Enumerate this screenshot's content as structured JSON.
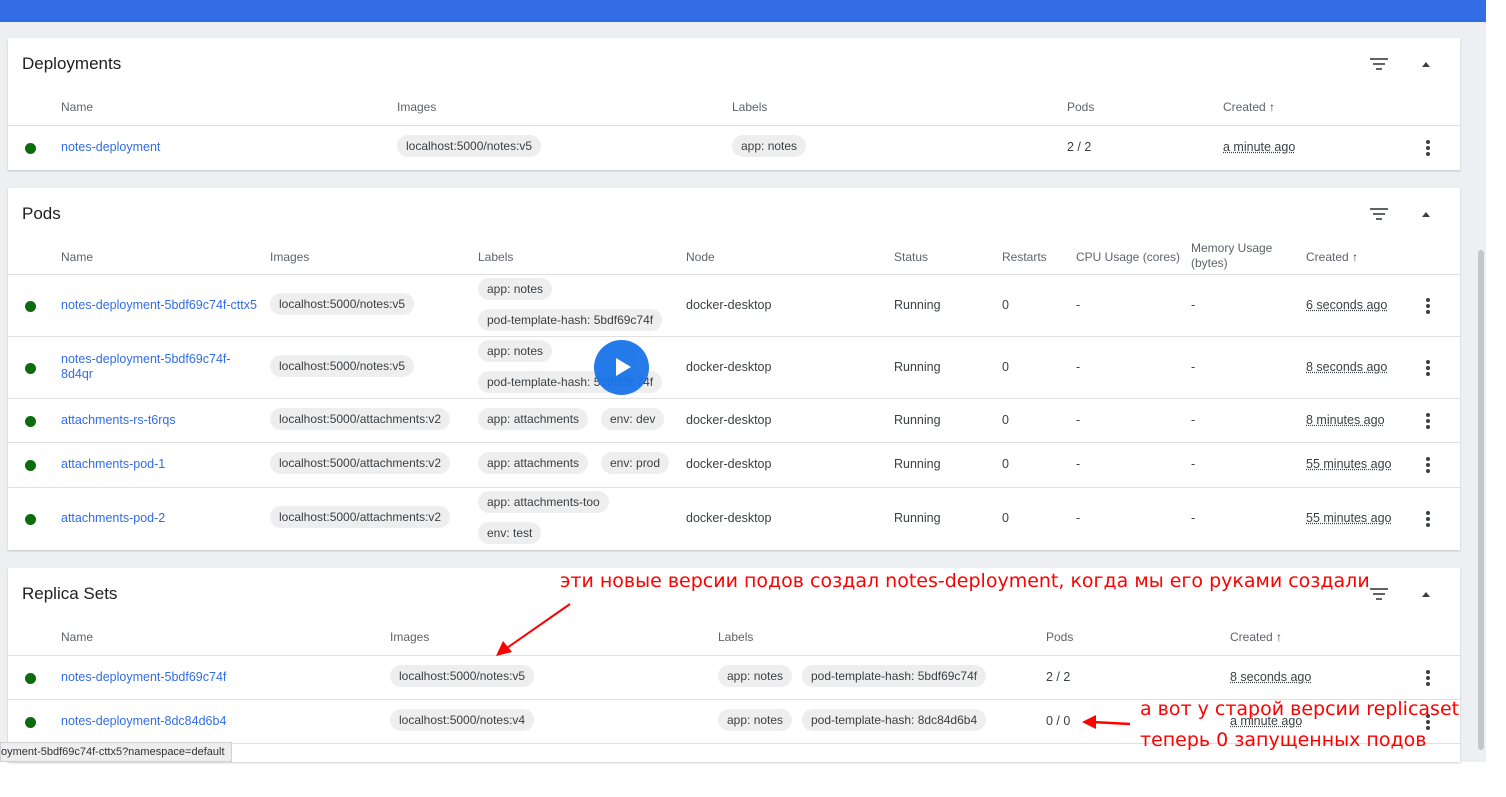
{
  "deployments": {
    "title": "Deployments",
    "headers": {
      "name": "Name",
      "images": "Images",
      "labels": "Labels",
      "pods": "Pods",
      "created": "Created"
    },
    "rows": [
      {
        "name": "notes-deployment",
        "image": "localhost:5000/notes:v5",
        "labels": [
          "app: notes"
        ],
        "pods": "2 / 2",
        "created": "a minute ago"
      }
    ]
  },
  "pods": {
    "title": "Pods",
    "headers": {
      "name": "Name",
      "images": "Images",
      "labels": "Labels",
      "node": "Node",
      "status": "Status",
      "restarts": "Restarts",
      "cpu": "CPU Usage (cores)",
      "memory": "Memory Usage (bytes)",
      "created": "Created"
    },
    "rows": [
      {
        "name": "notes-deployment-5bdf69c74f-cttx5",
        "image": "localhost:5000/notes:v5",
        "labels": [
          "app: notes",
          "pod-template-hash: 5bdf69c74f"
        ],
        "node": "docker-desktop",
        "status": "Running",
        "restarts": "0",
        "cpu": "-",
        "memory": "-",
        "created": "6 seconds ago"
      },
      {
        "name": "notes-deployment-5bdf69c74f-8d4qr",
        "image": "localhost:5000/notes:v5",
        "labels": [
          "app: notes",
          "pod-template-hash: 5bdf69c74f"
        ],
        "node": "docker-desktop",
        "status": "Running",
        "restarts": "0",
        "cpu": "-",
        "memory": "-",
        "created": "8 seconds ago"
      },
      {
        "name": "attachments-rs-t6rqs",
        "image": "localhost:5000/attachments:v2",
        "labels": [
          "app: attachments",
          "env: dev"
        ],
        "node": "docker-desktop",
        "status": "Running",
        "restarts": "0",
        "cpu": "-",
        "memory": "-",
        "created": "8 minutes ago"
      },
      {
        "name": "attachments-pod-1",
        "image": "localhost:5000/attachments:v2",
        "labels": [
          "app: attachments",
          "env: prod"
        ],
        "node": "docker-desktop",
        "status": "Running",
        "restarts": "0",
        "cpu": "-",
        "memory": "-",
        "created": "55 minutes ago"
      },
      {
        "name": "attachments-pod-2",
        "image": "localhost:5000/attachments:v2",
        "labels": [
          "app: attachments-too",
          "env: test"
        ],
        "node": "docker-desktop",
        "status": "Running",
        "restarts": "0",
        "cpu": "-",
        "memory": "-",
        "created": "55 minutes ago"
      }
    ]
  },
  "replica_sets": {
    "title": "Replica Sets",
    "headers": {
      "name": "Name",
      "images": "Images",
      "labels": "Labels",
      "pods": "Pods",
      "created": "Created"
    },
    "rows": [
      {
        "name": "notes-deployment-5bdf69c74f",
        "image": "localhost:5000/notes:v5",
        "labels": [
          "app: notes",
          "pod-template-hash: 5bdf69c74f"
        ],
        "pods": "2 / 2",
        "created": "8 seconds ago"
      },
      {
        "name": "notes-deployment-8dc84d6b4",
        "image": "localhost:5000/notes:v4",
        "labels": [
          "app: notes",
          "pod-template-hash: 8dc84d6b4"
        ],
        "pods": "0 / 0",
        "created": "a minute ago"
      }
    ]
  },
  "annotations": {
    "top": "эти новые версии подов создал notes-deployment, когда мы его руками создали",
    "bottom_line1": "а вот у старой версии replicaset",
    "bottom_line2": "теперь 0 запущенных подов",
    "color": "#ff0000"
  },
  "status_bar": "oyment-5bdf69c74f-cttx5?namespace=default",
  "icons": {
    "filter": "filter-icon",
    "collapse": "chevron-up-icon",
    "more": "more-vert-icon",
    "status": "status-ok-icon",
    "play": "play-icon",
    "sort": "arrow-up-icon"
  }
}
